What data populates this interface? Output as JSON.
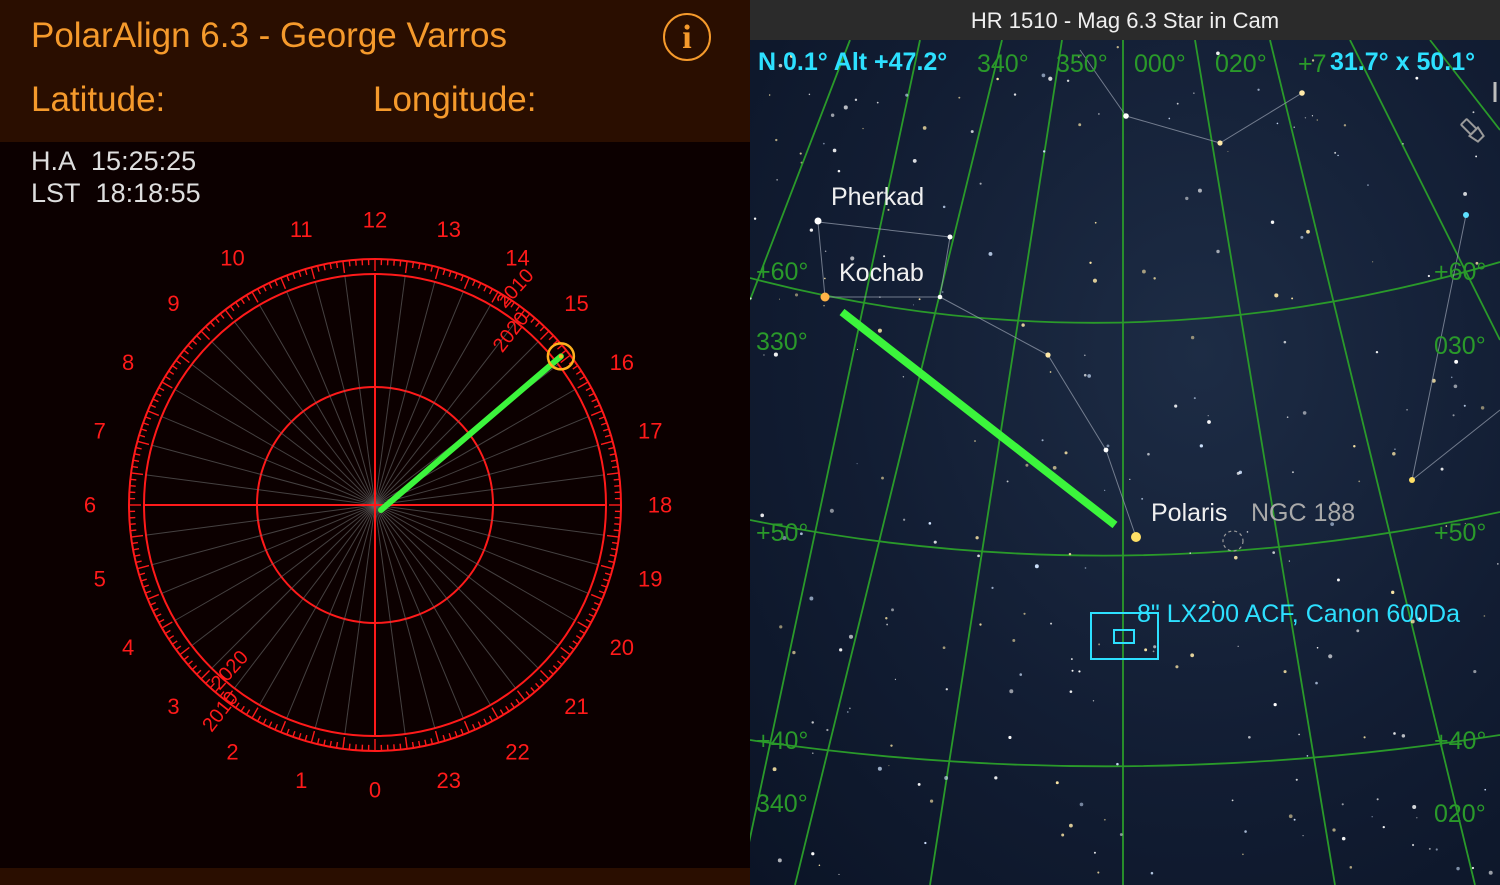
{
  "left_panel": {
    "title": "PolarAlign 6.3 - George Varros",
    "latitude_label": "Latitude:",
    "longitude_label": "Longitude:",
    "info_icon": "i",
    "ha_label": "H.A",
    "ha_value": "15:25:25",
    "lst_label": "LST",
    "lst_value": "18:18:55",
    "dial": {
      "hour_labels": [
        "0",
        "1",
        "2",
        "3",
        "4",
        "5",
        "6",
        "7",
        "8",
        "9",
        "10",
        "11",
        "12",
        "13",
        "14",
        "15",
        "16",
        "17",
        "18",
        "19",
        "20",
        "21",
        "22",
        "23"
      ],
      "epoch_labels_upper": [
        "2010",
        "2020"
      ],
      "epoch_labels_lower": [
        "2020",
        "2010"
      ],
      "polaris_hour_angle": "15:25:25"
    },
    "colors": {
      "accent": "#f59a2c",
      "dial": "#ff1a1a",
      "pointer": "#3cf53c",
      "header_bg": "#2a0e00"
    }
  },
  "right_panel": {
    "title": "HR 1510 - Mag 6.3 Star in Cam",
    "nav_readout": "N 0.1° Alt +47.2°",
    "fov_readout": "31.7° x 50.1°",
    "star_labels": {
      "pherkad": "Pherkad",
      "kochab": "Kochab",
      "polaris": "Polaris",
      "ngc": "NGC 188"
    },
    "fov_box_label": "8\" LX200 ACF, Canon 600Da",
    "grid_labels": {
      "ra_top": [
        "340°",
        "350°",
        "000°",
        "020°"
      ],
      "ra_top_partial": "+7",
      "dec_60_left": "+60°",
      "dec_60_right": "+60°",
      "ra_330": "330°",
      "ra_030": "030°",
      "dec_50_left": "+50°",
      "dec_50_right": "+50°",
      "dec_40_left": "+40°",
      "dec_40_right": "+40°",
      "ra_340_bottom": "340°",
      "ra_020_bottom": "020°"
    },
    "icons": [
      "flashlight-icon"
    ],
    "colors": {
      "grid": "#2a9a2a",
      "readout": "#2de0ff",
      "pointer": "#3cf53c"
    }
  }
}
